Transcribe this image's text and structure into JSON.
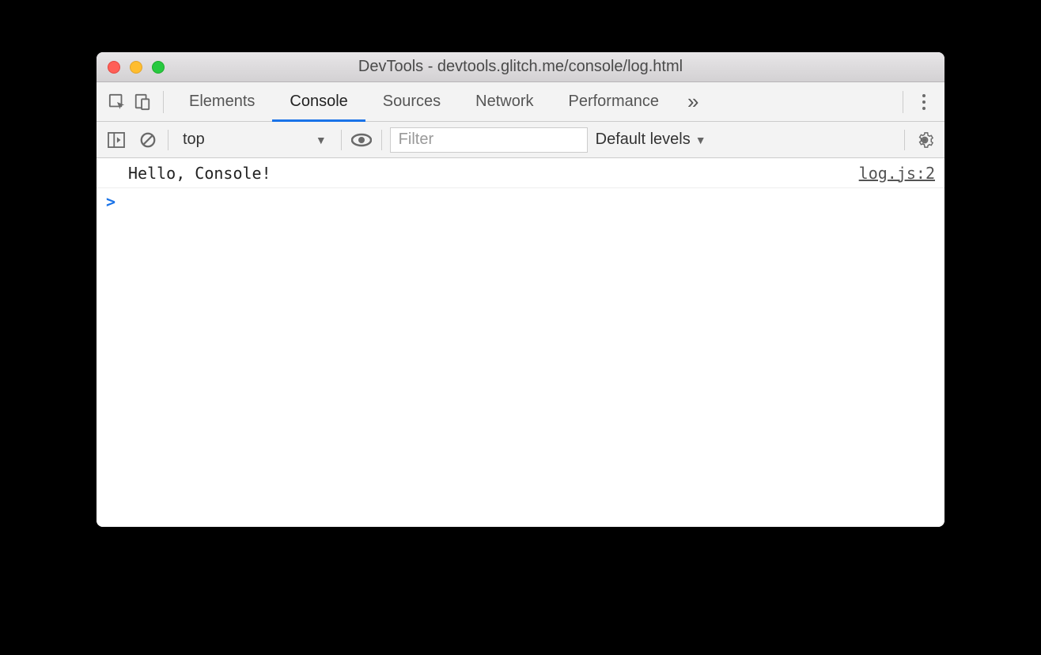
{
  "window": {
    "title": "DevTools - devtools.glitch.me/console/log.html"
  },
  "tabs": {
    "items": [
      "Elements",
      "Console",
      "Sources",
      "Network",
      "Performance"
    ],
    "active": "Console",
    "overflow_glyph": "»"
  },
  "subbar": {
    "context": "top",
    "filter_placeholder": "Filter",
    "levels_label": "Default levels"
  },
  "console": {
    "logs": [
      {
        "message": "Hello, Console!",
        "source": "log.js:2"
      }
    ],
    "prompt": ">"
  }
}
